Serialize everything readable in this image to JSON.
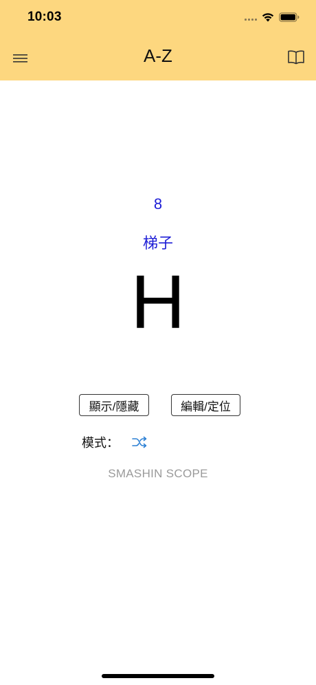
{
  "status_bar": {
    "time": "10:03",
    "icons": [
      "cellular-dots-icon",
      "wifi-icon",
      "battery-icon"
    ]
  },
  "nav": {
    "title": "A-Z",
    "left_icon": "hamburger-menu-icon",
    "right_icon": "book-icon"
  },
  "card": {
    "number": "8",
    "word": "梯子",
    "letter": "H"
  },
  "buttons": {
    "toggle_label": "顯示/隱藏",
    "edit_label": "編輯/定位"
  },
  "mode": {
    "label": "模式：",
    "icon": "shuffle-icon"
  },
  "footer": {
    "brand": "SMASHIN SCOPE"
  },
  "colors": {
    "header_bg": "#fdd77f",
    "accent_text": "#1d1dd6",
    "icon_blue": "#2a7fd4",
    "muted_text": "#9a9a9a"
  }
}
